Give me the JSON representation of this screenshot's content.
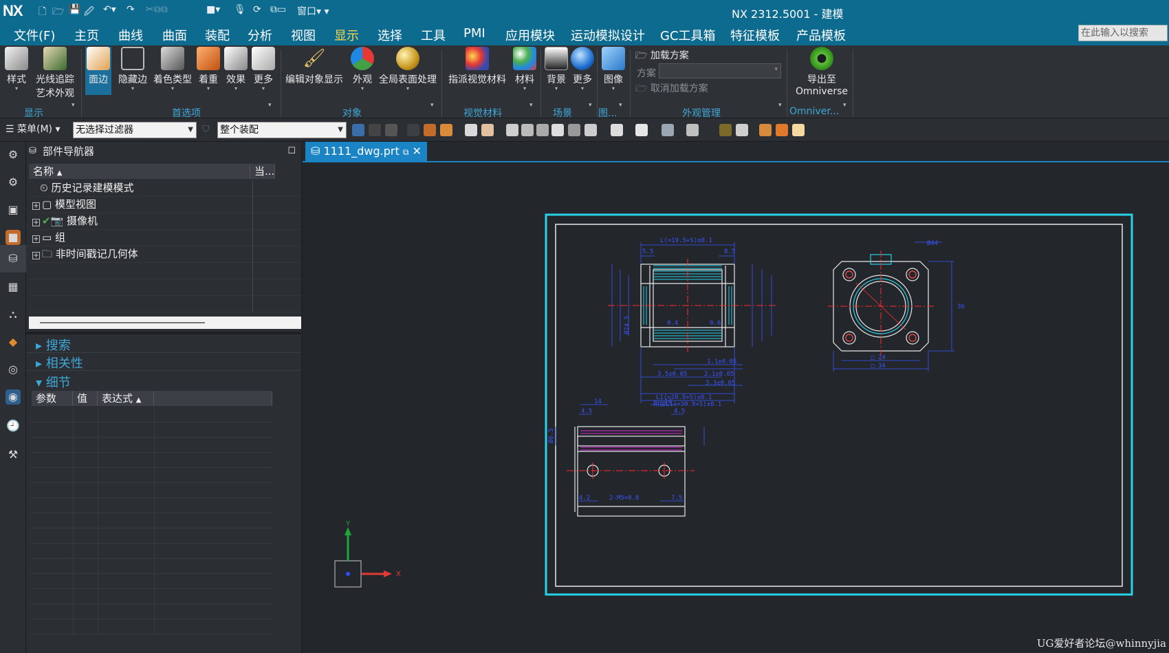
{
  "app": {
    "logo": "NX",
    "title": "NX 2312.5001 - 建模"
  },
  "menu": {
    "items": [
      "文件(F)",
      "主页",
      "曲线",
      "曲面",
      "装配",
      "分析",
      "视图",
      "显示",
      "选择",
      "工具",
      "PMI",
      "应用模块",
      "运动模拟设计",
      "GC工具箱",
      "特征模板",
      "产品模板"
    ],
    "active": "显示",
    "search_placeholder": "在此输入以搜索"
  },
  "ribbon": {
    "buttons": {
      "style": "样式",
      "raytrace_1": "光线追踪",
      "raytrace_2": "艺术外观",
      "face_edge": "面边",
      "hidden_edge": "隐藏边",
      "shading_type": "着色类型",
      "emphasis": "着重",
      "effects": "效果",
      "more1": "更多",
      "edit_object_display": "编辑对象显示",
      "appearance": "外观",
      "global_surface": "全局表面处理",
      "assign_visual_material": "指派视觉材料",
      "material": "材料",
      "background": "背景",
      "more2": "更多",
      "image": "图像",
      "load_scheme": "加载方案",
      "scheme_label": "方案",
      "unload_scheme": "取消加载方案",
      "export_to": "导出至",
      "omniverse": "Omniverse"
    },
    "groups": {
      "display": "显示",
      "preferences": "首选项",
      "object": "对象",
      "visual_material": "视觉材料",
      "scene": "场景",
      "image": "图...",
      "appearance_mgmt": "外观管理",
      "omniverse": "Omniver..."
    }
  },
  "toolbar2": {
    "menu": "菜单(M)",
    "filter": "无选择过滤器",
    "assembly": "整个装配"
  },
  "navigator": {
    "title": "部件导航器",
    "col_name": "名称",
    "col_current": "当...",
    "tree": [
      "历史记录建模模式",
      "模型视图",
      "摄像机",
      "组",
      "非时间戳记几何体"
    ],
    "sections": {
      "search": "搜索",
      "dependency": "相关性",
      "details": "细节"
    },
    "details_cols": [
      "参数",
      "值",
      "表达式"
    ]
  },
  "tab": {
    "label": "1111_dwg.prt"
  },
  "drawing": {
    "dims": {
      "L_top": "L(=19.5+S)±0.1",
      "d85": "8.5",
      "d55": "5.5",
      "h245": "Ø24.5",
      "d04": "0.4",
      "d06": "0.6",
      "d11": "1.1±0.05",
      "d35": "3.5±0.05",
      "d21": "2.1±0.05",
      "d33": "3.3±0.05",
      "L1": "L1(=20.9+S)±0.1",
      "L1_bot": "附加L1(=30.9+S)±0.1",
      "phi44": "Ø44",
      "r36": "36",
      "sq24": "□ 24",
      "sq34": "□ 34",
      "d14a": "14",
      "d14b": "14",
      "d45a": "4.5",
      "d45b": "4.5",
      "d42": "4.2",
      "d75": "7.5",
      "m5": "2-M5×0.8",
      "phi6": "Ø6.5"
    }
  },
  "triad": {
    "y": "Y",
    "x": "X"
  },
  "watermark": "UG爱好者论坛@whinnyjia",
  "colors": {
    "accent": "#0c6b8f",
    "cyan": "#27d3e6",
    "selected_tab": "#1b84c4"
  }
}
